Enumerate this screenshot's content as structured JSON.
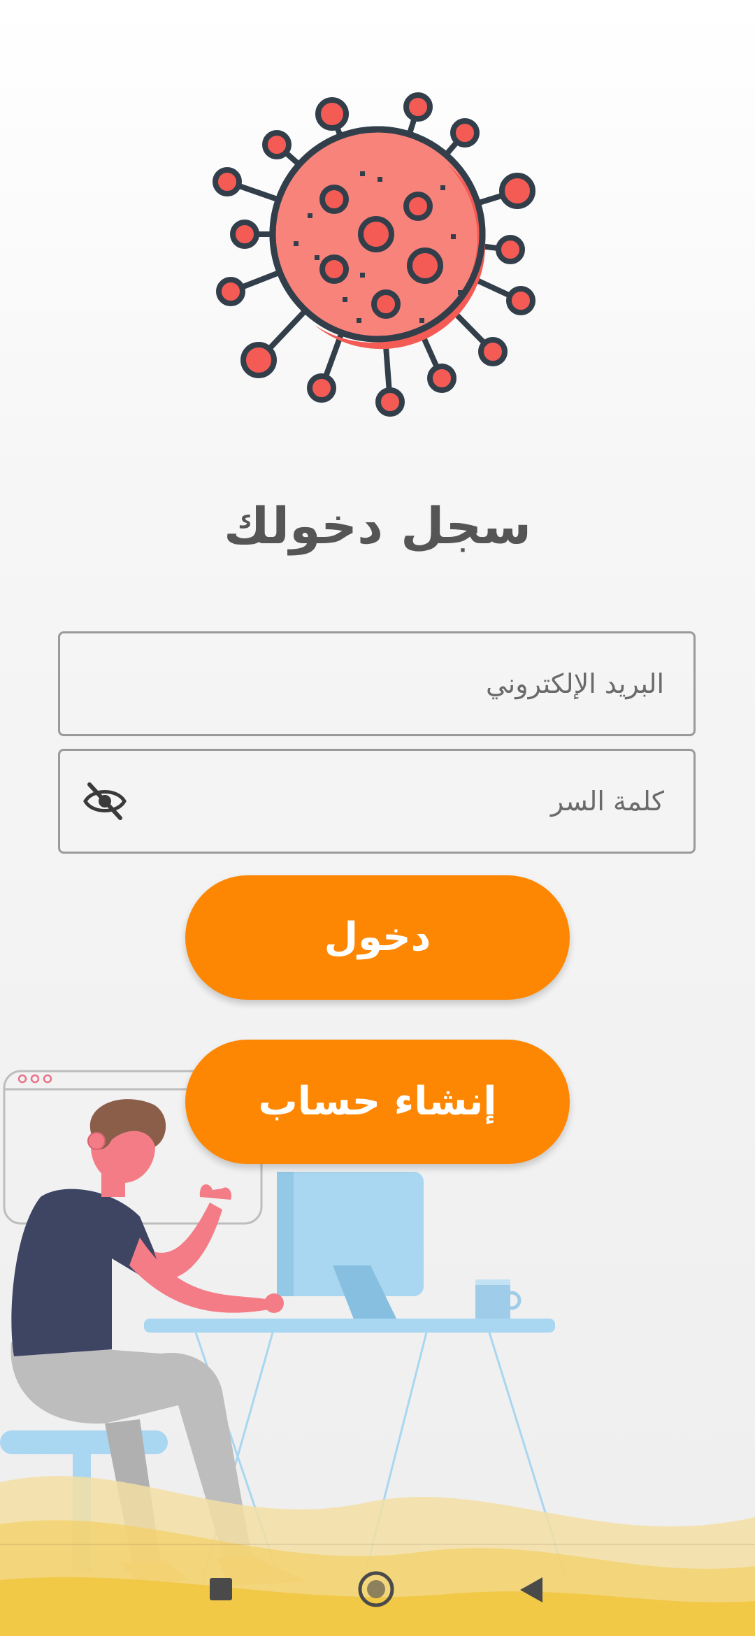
{
  "login": {
    "title": "سجل دخولك",
    "email_placeholder": "البريد الإلكتروني",
    "password_placeholder": "كلمة السر",
    "login_label": "دخول",
    "signup_label": "إنشاء حساب"
  },
  "icons": {
    "logo": "virus-icon",
    "password_toggle": "eye-off-icon",
    "nav_recent": "square-icon",
    "nav_home": "circle-icon",
    "nav_back": "triangle-back-icon"
  },
  "colors": {
    "accent": "#fd8702",
    "virus": "#f45b55",
    "virus_outline": "#323f4b",
    "title": "#555555"
  }
}
